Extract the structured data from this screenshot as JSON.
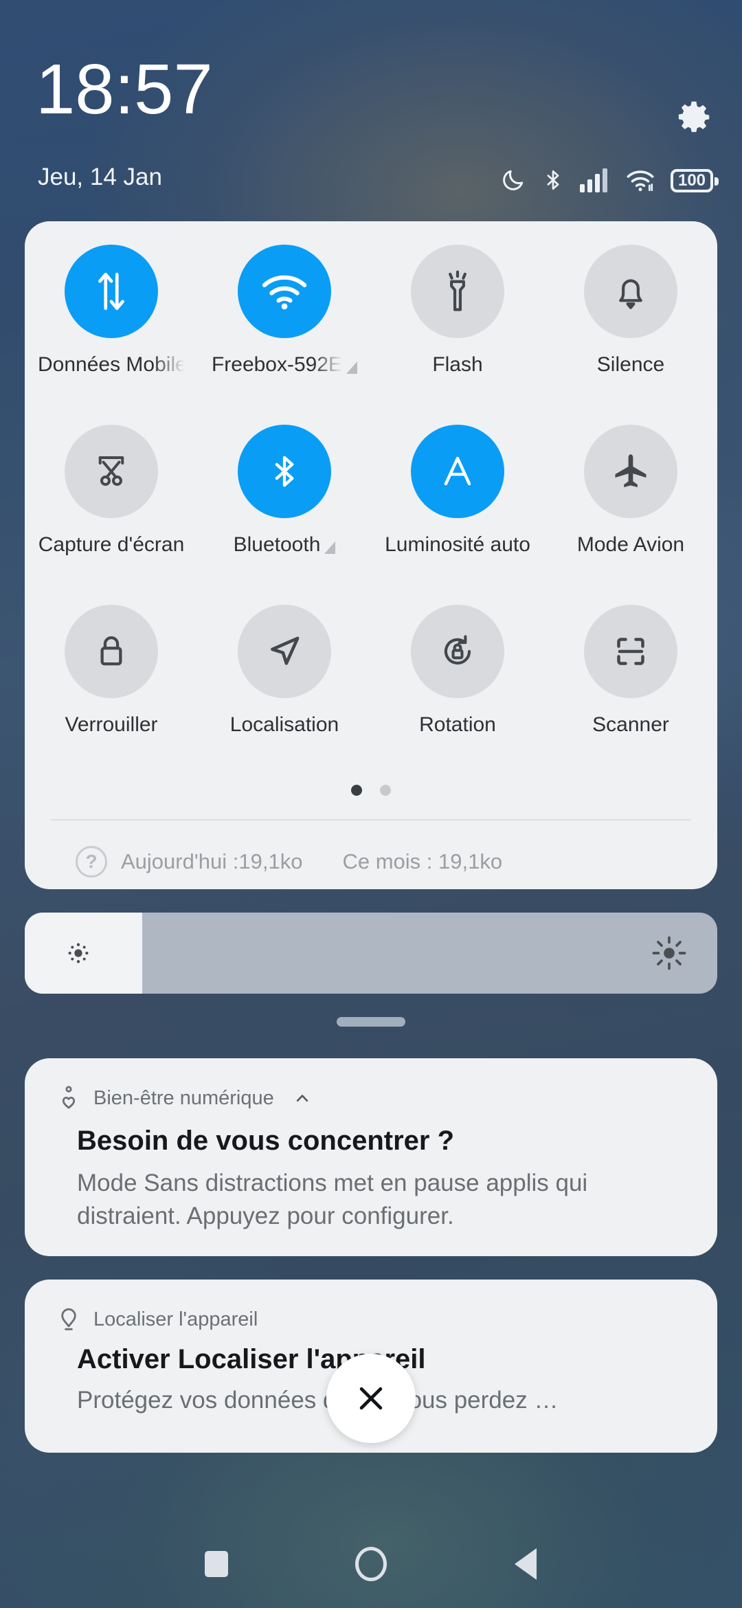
{
  "header": {
    "clock": "18:57",
    "date": "Jeu, 14 Jan",
    "settings_icon": "gear-icon",
    "status_icons": [
      "do-not-disturb-moon-icon",
      "bluetooth-icon",
      "cellular-signal-icon",
      "wifi-icon",
      "battery-icon"
    ],
    "battery_level": "100"
  },
  "quick_settings": {
    "tiles": [
      {
        "label": "Données Mobile",
        "icon": "mobile-data-icon",
        "active": true,
        "badge": false
      },
      {
        "label": "Freebox-592E",
        "icon": "wifi-icon",
        "active": true,
        "badge": true
      },
      {
        "label": "Flash",
        "icon": "flashlight-icon",
        "active": false,
        "badge": false
      },
      {
        "label": "Silence",
        "icon": "bell-icon",
        "active": false,
        "badge": false
      },
      {
        "label": "Capture d'écran",
        "icon": "screenshot-icon",
        "active": false,
        "badge": false
      },
      {
        "label": "Bluetooth",
        "icon": "bluetooth-icon",
        "active": true,
        "badge": true
      },
      {
        "label": "Luminosité auto",
        "icon": "auto-brightness-icon",
        "active": true,
        "badge": false
      },
      {
        "label": "Mode Avion",
        "icon": "airplane-icon",
        "active": false,
        "badge": false
      },
      {
        "label": "Verrouiller",
        "icon": "lock-icon",
        "active": false,
        "badge": false
      },
      {
        "label": "Localisation",
        "icon": "location-arrow-icon",
        "active": false,
        "badge": false
      },
      {
        "label": "Rotation",
        "icon": "rotation-lock-icon",
        "active": false,
        "badge": false
      },
      {
        "label": "Scanner",
        "icon": "scanner-frame-icon",
        "active": false,
        "badge": false
      }
    ],
    "pages": 2,
    "current_page": 1,
    "data_usage": {
      "help_icon": "help-icon",
      "today": "Aujourd'hui :19,1ko",
      "month": "Ce mois : 19,1ko"
    },
    "accent_color": "#0a9df5",
    "inactive_color": "#d8dadd",
    "panel_color": "#eff1f3"
  },
  "brightness": {
    "level_percent": 17,
    "low_icon": "brightness-low-icon",
    "high_icon": "brightness-high-icon"
  },
  "drag_handle": "panel-drag-handle",
  "notifications": [
    {
      "app": "Bien-être numérique",
      "app_icon": "digital-wellbeing-icon",
      "expand_icon": "chevron-up-icon",
      "title": "Besoin de vous concentrer ?",
      "body": "Mode Sans distractions met en pause applis qui distraient. Appuyez pour configurer."
    },
    {
      "app": "Localiser l'appareil",
      "app_icon": "location-pin-icon",
      "title": "Activer Localiser l'appareil",
      "body": "Protégez vos données        quand vous perdez …"
    }
  ],
  "clear_all": {
    "icon": "close-x-icon"
  },
  "navbar": {
    "recents_icon": "recents-square-icon",
    "home_icon": "home-circle-icon",
    "back_icon": "back-triangle-icon"
  }
}
